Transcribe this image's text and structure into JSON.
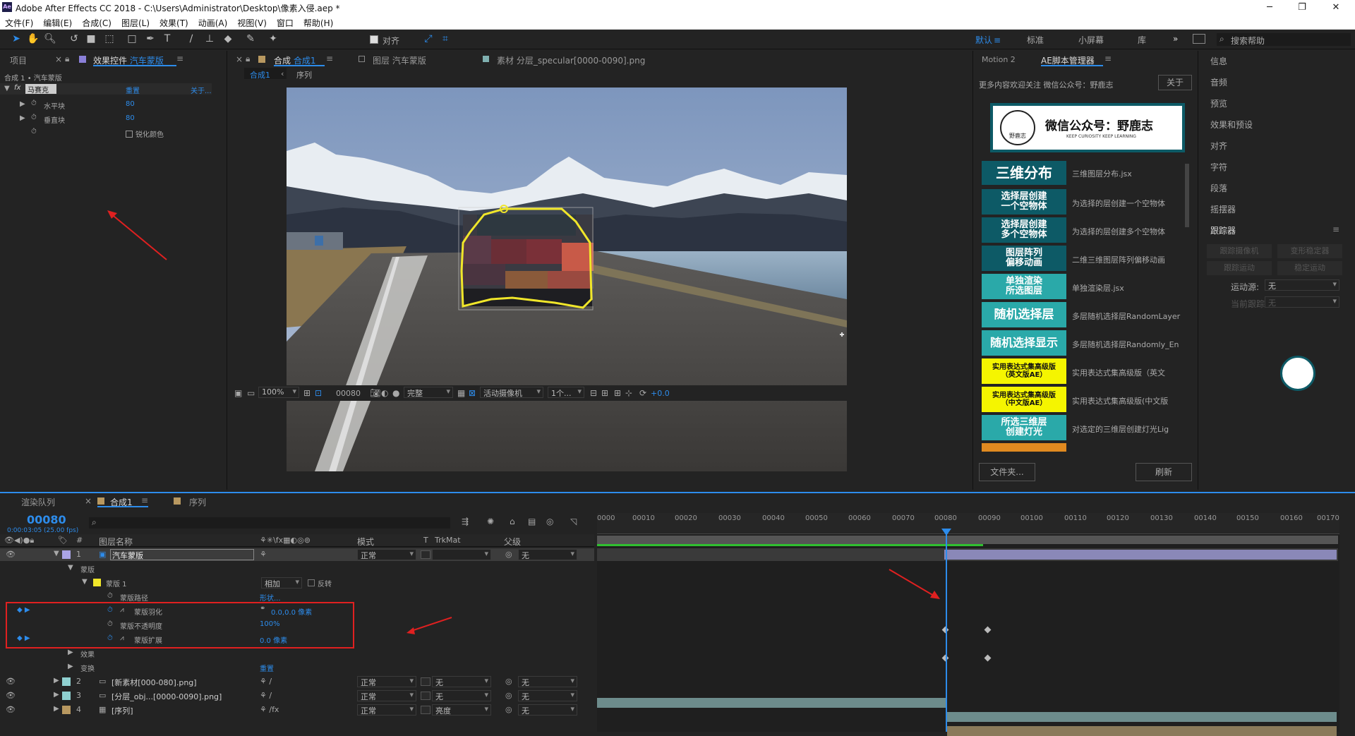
{
  "titlebar": {
    "title": "Adobe After Effects CC 2018 - C:\\Users\\Administrator\\Desktop\\像素入侵.aep *",
    "logo": "Ae"
  },
  "menu": [
    "文件(F)",
    "编辑(E)",
    "合成(C)",
    "图层(L)",
    "效果(T)",
    "动画(A)",
    "视图(V)",
    "窗口",
    "帮助(H)"
  ],
  "toolbar": {
    "align_label": "对齐",
    "workspaces": [
      "默认",
      "标准",
      "小屏幕",
      "库"
    ],
    "more": "»",
    "search_placeholder": "搜索帮助"
  },
  "project_panel": {
    "tab_project": "项目",
    "tab_effects_prefix": "效果控件",
    "tab_effects_layer": "汽车蒙版",
    "breadcrumb": "合成 1 • 汽车蒙版",
    "effect_name": "马赛克",
    "reset": "重置",
    "about": "关于...",
    "props": [
      {
        "label": "水平块",
        "value": "80"
      },
      {
        "label": "垂直块",
        "value": "80"
      },
      {
        "label": "锐化颜色",
        "value": ""
      }
    ]
  },
  "viewer": {
    "tab_comp_prefix": "合成",
    "tab_comp": "合成1",
    "tab_layer": "图层 汽车蒙版",
    "tab_footage": "素材 分层_specular[0000-0090].png",
    "sub_tab": "合成1",
    "sub_tab2": "序列",
    "zoom": "100%",
    "frame": "00080",
    "quality": "完整",
    "camera": "活动摄像机",
    "views": "1个...",
    "exposure": "+0.0"
  },
  "script_panel": {
    "tab1": "Motion 2",
    "tab2": "AE脚本管理器",
    "notice": "更多内容欢迎关注 微信公众号：野鹿志",
    "about_btn": "关于",
    "banner_title": "微信公众号：野鹿志",
    "banner_sub": "KEEP CURIOSITY KEEP LEARNING",
    "logo_text": "野鹿志",
    "items": [
      {
        "label": "三维分布",
        "desc": "三维图层分布.jsx",
        "style": "teal"
      },
      {
        "label": "选择层创建\n一个空物体",
        "desc": "为选择的层创建一个空物体",
        "style": "teal"
      },
      {
        "label": "选择层创建\n多个空物体",
        "desc": "为选择的层创建多个空物体",
        "style": "teal"
      },
      {
        "label": "图层阵列\n偏移动画",
        "desc": "二维三维图层阵列偏移动画",
        "style": "teal"
      },
      {
        "label": "单独渲染\n所选图层",
        "desc": "单独渲染层.jsx",
        "style": "cyan"
      },
      {
        "label": "随机选择层",
        "desc": "多层随机选择层RandomLayer",
        "style": "cyan"
      },
      {
        "label": "随机选择显示",
        "desc": "多层随机选择层Randomly_En",
        "style": "cyan"
      },
      {
        "label": "实用表达式集高级版\n（英文版AE）",
        "desc": "实用表达式集高级版（英文",
        "style": "yellow"
      },
      {
        "label": "实用表达式集高级版\n（中文版AE）",
        "desc": "实用表达式集高级版(中文版",
        "style": "yellow"
      },
      {
        "label": "所选三维层\n创建灯光",
        "desc": "对选定的三维层创建灯光Lig",
        "style": "cyan"
      }
    ],
    "folder_btn": "文件夹...",
    "refresh_btn": "刷新"
  },
  "right_panel": {
    "items": [
      "信息",
      "音频",
      "预览",
      "效果和预设",
      "对齐",
      "字符",
      "段落",
      "摇摆器"
    ],
    "tracker": "跟踪器",
    "track_camera": "跟踪摄像机",
    "warp_stabilizer": "变形稳定器",
    "track_motion": "跟踪运动",
    "stabilize_motion": "稳定运动",
    "motion_source_label": "运动源:",
    "motion_source_value": "无",
    "current_track_label": "当前跟踪:",
    "current_track_value": "无"
  },
  "timeline": {
    "tab_render": "渲染队列",
    "tab_comp": "合成1",
    "tab_seq": "序列",
    "timecode": "00080",
    "timecode_sub": "0:00:03:05 (25.00 fps)",
    "search_placeholder": "",
    "col_name": "图层名称",
    "col_mode": "模式",
    "col_t": "T",
    "col_trkmat": "TrkMat",
    "col_parent": "父级",
    "ruler": [
      "0000",
      "00010",
      "00020",
      "00030",
      "00040",
      "00050",
      "00060",
      "00070",
      "00080",
      "00090",
      "00100",
      "00110",
      "00120",
      "00130",
      "00140",
      "00150",
      "00160",
      "00170"
    ],
    "layers": [
      {
        "num": "1",
        "name": "汽车蒙版",
        "mode": "正常",
        "trk": "",
        "parent": "无"
      },
      {
        "num": "2",
        "name": "[新素材[000-080].png]",
        "mode": "正常",
        "trk": "无",
        "parent": "无"
      },
      {
        "num": "3",
        "name": "[分层_obj...[0000-0090].png]",
        "mode": "正常",
        "trk": "无",
        "parent": "无"
      },
      {
        "num": "4",
        "name": "[序列]",
        "mode": "正常",
        "trk": "亮度",
        "parent": "无"
      }
    ],
    "masks_label": "蒙版",
    "mask1": "蒙版 1",
    "mask_mode": "相加",
    "invert": "反转",
    "mask_path": "蒙版路径",
    "mask_path_val": "形状...",
    "mask_feather": "蒙版羽化",
    "mask_feather_val": "0.0,0.0 像素",
    "mask_opacity": "蒙版不透明度",
    "mask_opacity_val": "100%",
    "mask_expand": "蒙版扩展",
    "mask_expand_val": "0.0 像素",
    "effects": "效果",
    "transform": "变换",
    "transform_reset": "重置"
  },
  "colors": {
    "accent": "#2d8ceb",
    "teal": "#0d5a66",
    "cyan": "#2aa9a9",
    "yellow": "#f5f500",
    "annotation": "#e02020",
    "mask": "#f0e62a"
  }
}
